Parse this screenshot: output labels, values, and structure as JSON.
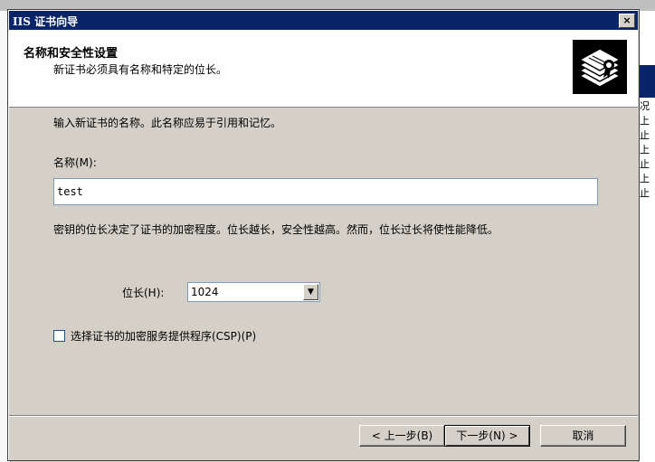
{
  "dialog": {
    "title": "IIS 证书向导",
    "close_glyph": "×",
    "header": {
      "title": "名称和安全性设置",
      "subtitle": "新证书必须具有名称和特定的位长。",
      "icon": "certificate-icon"
    },
    "instruction": "输入新证书的名称。此名称应易于引用和记忆。",
    "name_label": "名称(M):",
    "name_value": "test",
    "bitlength_note": "密钥的位长决定了证书的加密程度。位长越长，安全性越高。然而，位长过长将使性能降低。",
    "bitlength_label": "位长(H):",
    "bitlength_value": "1024",
    "csp_label": "选择证书的加密服务提供程序(CSP)(P)",
    "csp_checked": false,
    "buttons": {
      "back": "< 上一步(B)",
      "next": "下一步(N) >",
      "cancel": "取消"
    }
  },
  "background": {
    "right_panel_items": [
      "况",
      "上",
      "止",
      "上",
      "止",
      "上",
      "止"
    ]
  }
}
